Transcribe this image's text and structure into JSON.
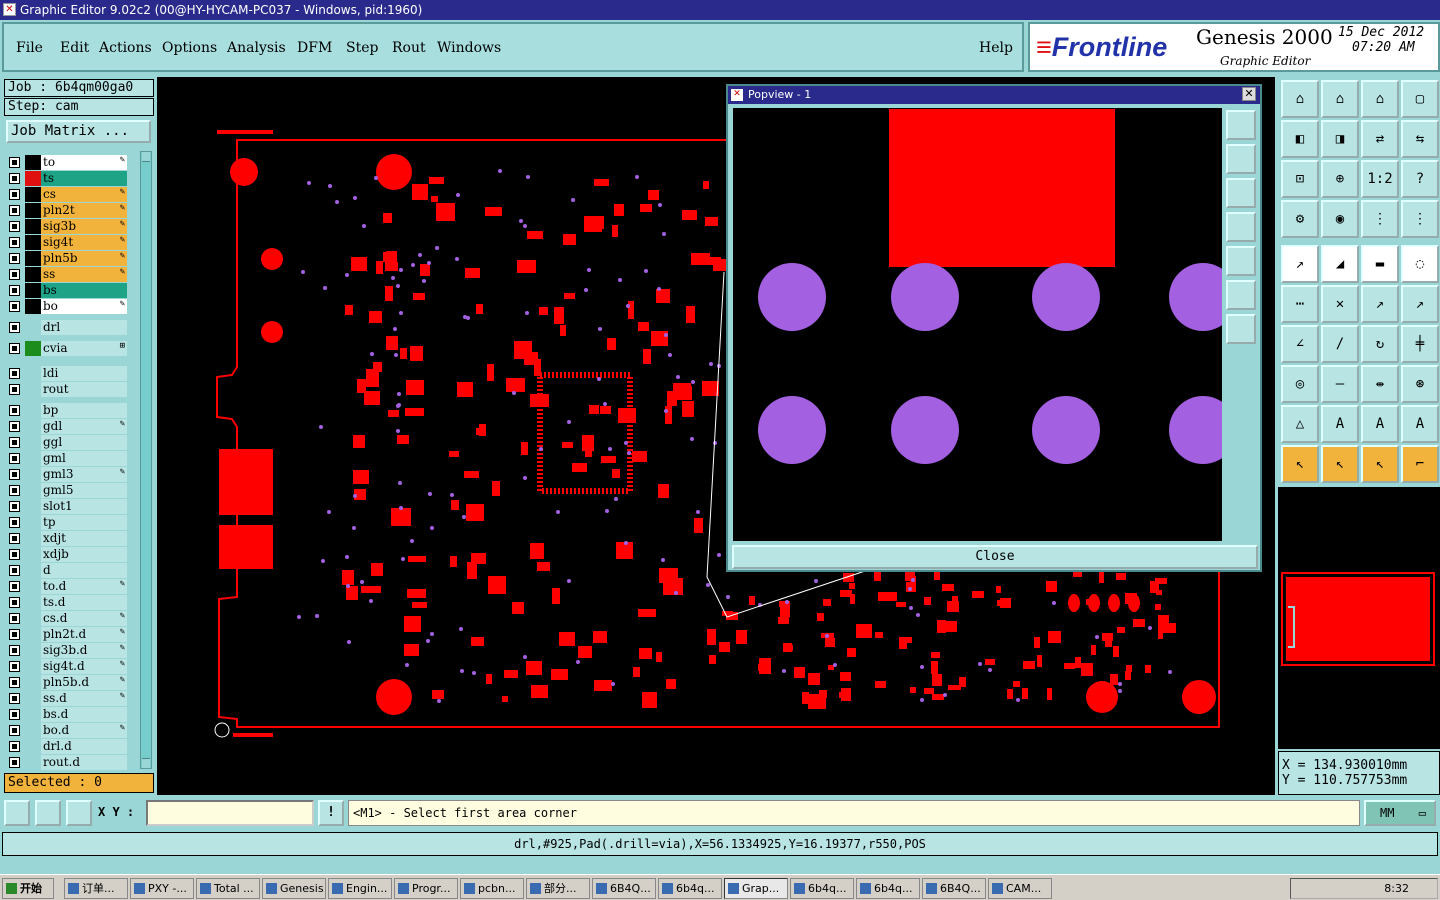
{
  "window": {
    "title": "Graphic Editor 9.02c2 (00@HY-HYCAM-PC037 - Windows, pid:1960)"
  },
  "menu": {
    "items": [
      "File",
      "Edit",
      "Actions",
      "Options",
      "Analysis",
      "DFM",
      "Step",
      "Rout",
      "Windows"
    ],
    "help": "Help"
  },
  "brand": {
    "logo": "Frontline",
    "product": "Genesis 2000",
    "subtitle": "Graphic Editor",
    "date": "15 Dec 2012",
    "time": "07:20 AM"
  },
  "job": {
    "job_label": "Job : 6b4qm00ga0",
    "step_label": "Step: cam",
    "matrix_button": "Job Matrix ..."
  },
  "layers": [
    {
      "name": "to",
      "color": "#ffffff",
      "swatch": "#000000",
      "mark": "✎"
    },
    {
      "name": "ts",
      "color": "#1ea386",
      "swatch": "#e01010",
      "mark": ""
    },
    {
      "name": "cs",
      "color": "#f2b33d",
      "swatch": "#000000",
      "mark": "✎"
    },
    {
      "name": "pln2t",
      "color": "#f2b33d",
      "swatch": "#000000",
      "mark": "✎"
    },
    {
      "name": "sig3b",
      "color": "#f2b33d",
      "swatch": "#000000",
      "mark": "✎"
    },
    {
      "name": "sig4t",
      "color": "#f2b33d",
      "swatch": "#000000",
      "mark": "✎"
    },
    {
      "name": "pln5b",
      "color": "#f2b33d",
      "swatch": "#000000",
      "mark": "✎"
    },
    {
      "name": "ss",
      "color": "#f2b33d",
      "swatch": "#000000",
      "mark": "✎"
    },
    {
      "name": "bs",
      "color": "#1ea386",
      "swatch": "#000000",
      "mark": ""
    },
    {
      "name": "bo",
      "color": "#ffffff",
      "swatch": "#000000",
      "mark": "✎"
    },
    {
      "name": "drl",
      "color": "#b8e4e4",
      "swatch": "#9ad6d6",
      "mark": ""
    },
    {
      "name": "cvia",
      "color": "#b8e4e4",
      "swatch": "#1c8c1c",
      "mark": "⊞"
    },
    {
      "name": "ldi",
      "color": "#b8e4e4",
      "swatch": "#9ad6d6",
      "mark": ""
    },
    {
      "name": "rout",
      "color": "#b8e4e4",
      "swatch": "#9ad6d6",
      "mark": ""
    },
    {
      "name": "bp",
      "color": "#b8e4e4",
      "swatch": "#9ad6d6",
      "mark": ""
    },
    {
      "name": "gdl",
      "color": "#b8e4e4",
      "swatch": "#9ad6d6",
      "mark": "✎"
    },
    {
      "name": "ggl",
      "color": "#b8e4e4",
      "swatch": "#9ad6d6",
      "mark": ""
    },
    {
      "name": "gml",
      "color": "#b8e4e4",
      "swatch": "#9ad6d6",
      "mark": ""
    },
    {
      "name": "gml3",
      "color": "#b8e4e4",
      "swatch": "#9ad6d6",
      "mark": "✎"
    },
    {
      "name": "gml5",
      "color": "#b8e4e4",
      "swatch": "#9ad6d6",
      "mark": ""
    },
    {
      "name": "slot1",
      "color": "#b8e4e4",
      "swatch": "#9ad6d6",
      "mark": ""
    },
    {
      "name": "tp",
      "color": "#b8e4e4",
      "swatch": "#9ad6d6",
      "mark": ""
    },
    {
      "name": "xdjt",
      "color": "#b8e4e4",
      "swatch": "#9ad6d6",
      "mark": ""
    },
    {
      "name": "xdjb",
      "color": "#b8e4e4",
      "swatch": "#9ad6d6",
      "mark": ""
    },
    {
      "name": "d",
      "color": "#b8e4e4",
      "swatch": "#9ad6d6",
      "mark": ""
    },
    {
      "name": "to.d",
      "color": "#b8e4e4",
      "swatch": "#9ad6d6",
      "mark": "✎"
    },
    {
      "name": "ts.d",
      "color": "#b8e4e4",
      "swatch": "#9ad6d6",
      "mark": ""
    },
    {
      "name": "cs.d",
      "color": "#b8e4e4",
      "swatch": "#9ad6d6",
      "mark": "✎"
    },
    {
      "name": "pln2t.d",
      "color": "#b8e4e4",
      "swatch": "#9ad6d6",
      "mark": "✎"
    },
    {
      "name": "sig3b.d",
      "color": "#b8e4e4",
      "swatch": "#9ad6d6",
      "mark": "✎"
    },
    {
      "name": "sig4t.d",
      "color": "#b8e4e4",
      "swatch": "#9ad6d6",
      "mark": "✎"
    },
    {
      "name": "pln5b.d",
      "color": "#b8e4e4",
      "swatch": "#9ad6d6",
      "mark": "✎"
    },
    {
      "name": "ss.d",
      "color": "#b8e4e4",
      "swatch": "#9ad6d6",
      "mark": "✎"
    },
    {
      "name": "bs.d",
      "color": "#b8e4e4",
      "swatch": "#9ad6d6",
      "mark": ""
    },
    {
      "name": "bo.d",
      "color": "#b8e4e4",
      "swatch": "#9ad6d6",
      "mark": "✎"
    },
    {
      "name": "drl.d",
      "color": "#b8e4e4",
      "swatch": "#9ad6d6",
      "mark": ""
    },
    {
      "name": "rout.d",
      "color": "#b8e4e4",
      "swatch": "#9ad6d6",
      "mark": ""
    }
  ],
  "selected": "Selected : 0",
  "popup": {
    "title": "Popview - 1",
    "close_label": "Close"
  },
  "coords": {
    "x": "X  =  134.930010mm",
    "y": "Y  =  110.757753mm"
  },
  "input": {
    "xy_label": "X Y :",
    "prompt": "<M1> - Select first area corner",
    "units": "MM"
  },
  "status": "drl,#925,Pad(.drill=via),X=56.1334925,Y=16.19377,r550,POS",
  "taskbar": {
    "start": "开始",
    "tasks": [
      "订单...",
      "PXY -...",
      "Total ...",
      "Genesis",
      "Engin...",
      "Progr...",
      "pcbn...",
      "部分...",
      "6B4Q...",
      "6b4q...",
      "Grap...",
      "6b4q...",
      "6b4q...",
      "6B4Q...",
      "CAM..."
    ],
    "clock": "8:32"
  },
  "colors": {
    "copper": "#ff0000",
    "via": "#a360e0",
    "teal": "#9ad6d6",
    "titlebar": "#2a2a8c"
  }
}
